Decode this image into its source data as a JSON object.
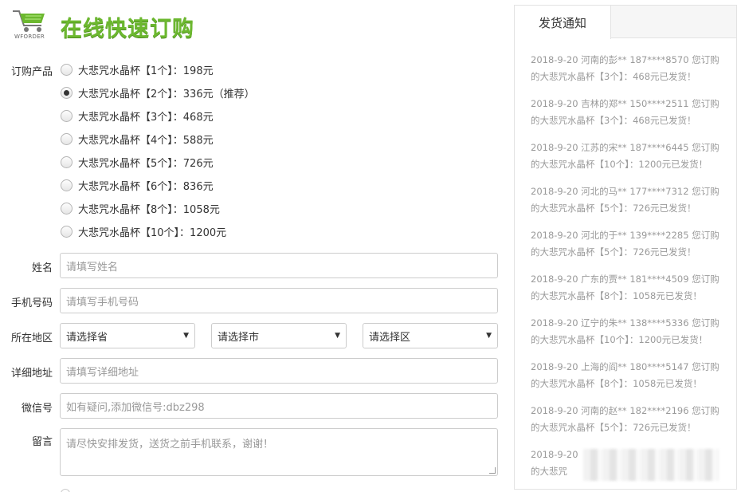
{
  "header": {
    "logo_text": "WFORDER",
    "title": "在线快速订购"
  },
  "form": {
    "product_label": "订购产品",
    "products": [
      {
        "text": "大悲咒水晶杯【1个】：198元",
        "checked": false
      },
      {
        "text": "大悲咒水晶杯【2个】：336元（推荐）",
        "checked": true
      },
      {
        "text": "大悲咒水晶杯【3个】：468元",
        "checked": false
      },
      {
        "text": "大悲咒水晶杯【4个】：588元",
        "checked": false
      },
      {
        "text": "大悲咒水晶杯【5个】：726元",
        "checked": false
      },
      {
        "text": "大悲咒水晶杯【6个】：836元",
        "checked": false
      },
      {
        "text": "大悲咒水晶杯【8个】：1058元",
        "checked": false
      },
      {
        "text": "大悲咒水晶杯【10个】：1200元",
        "checked": false
      }
    ],
    "name": {
      "label": "姓名",
      "placeholder": "请填写姓名"
    },
    "phone": {
      "label": "手机号码",
      "placeholder": "请填写手机号码"
    },
    "region": {
      "label": "所在地区",
      "province": "请选择省",
      "city": "请选择市",
      "district": "请选择区"
    },
    "address": {
      "label": "详细地址",
      "placeholder": "请填写详细地址"
    },
    "wechat": {
      "label": "微信号",
      "placeholder": "如有疑问,添加微信号:dbz298"
    },
    "message": {
      "label": "留言",
      "placeholder": "请尽快安排发货，送货之前手机联系，谢谢！"
    }
  },
  "sidebar": {
    "tab_label": "发货通知",
    "notices": [
      "2018-9-20 河南的彭** 187****8570 您订购的大悲咒水晶杯【3个】：468元已发货！",
      "2018-9-20 吉林的郑** 150****2511 您订购的大悲咒水晶杯【3个】：468元已发货！",
      "2018-9-20 江苏的宋** 187****6445 您订购的大悲咒水晶杯【10个】：1200元已发货！",
      "2018-9-20 河北的马** 177****7312 您订购的大悲咒水晶杯【5个】：726元已发货！",
      "2018-9-20 河北的于** 139****2285 您订购的大悲咒水晶杯【5个】：726元已发货！",
      "2018-9-20 广东的贾** 181****4509 您订购的大悲咒水晶杯【8个】：1058元已发货！",
      "2018-9-20 辽宁的朱** 138****5336 您订购的大悲咒水晶杯【10个】：1200元已发货！",
      "2018-9-20 上海的阎** 180****5147 您订购的大悲咒水晶杯【8个】：1058元已发货！",
      "2018-9-20 河南的赵** 182****2196 您订购的大悲咒水晶杯【5个】：726元已发货！",
      "2018-9-20 ",
      "的大悲咒"
    ]
  },
  "colors": {
    "title_green": "#6cb82f",
    "notice_gray": "#9a9a9a",
    "border": "#cccccc"
  }
}
